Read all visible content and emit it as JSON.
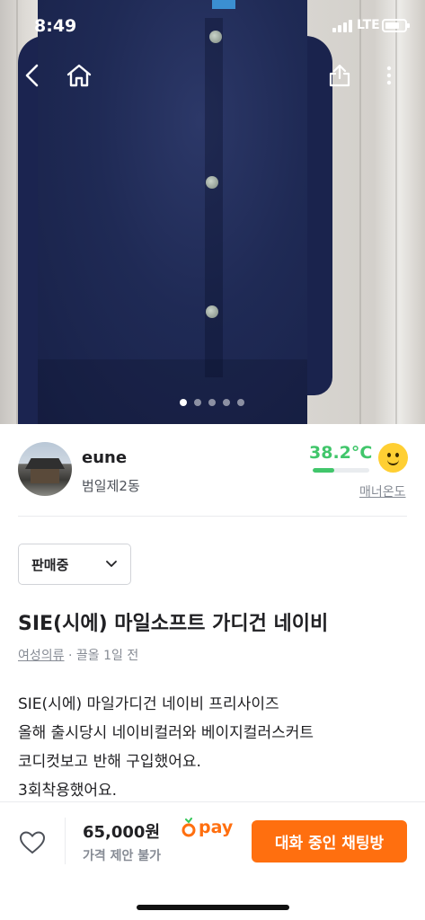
{
  "status_bar": {
    "time": "8:49",
    "network": "LTE"
  },
  "nav": {
    "back_icon": "chevron-left-icon",
    "home_icon": "home-icon",
    "share_icon": "share-icon",
    "more_icon": "more-vertical-icon"
  },
  "carousel": {
    "page_count": 5,
    "active_index": 0
  },
  "seller": {
    "nickname": "eune",
    "region": "범일제2동",
    "temperature": "38.2°C",
    "temperature_level": 0.38,
    "temperature_color": "#41c66b",
    "manner_label": "매너온도"
  },
  "product": {
    "sale_status": "판매중",
    "title": "SIE(시에) 마일소프트 가디건 네이비",
    "category": "여성의류",
    "meta_rest": " · 끌올 1일 전",
    "description": [
      "SIE(시에) 마일가디건 네이비 프리사이즈",
      "올해 출시당시 네이비컬러와 베이지컬러스커트",
      "코디컷보고 반해 구입했어요.",
      "3회착용했어요."
    ]
  },
  "bottom_bar": {
    "price": "65,000원",
    "negotiation": "가격 제안 불가",
    "pay_label": "pay",
    "chat_button": "대화 중인 채팅방",
    "accent_color": "#ff6f0f"
  }
}
